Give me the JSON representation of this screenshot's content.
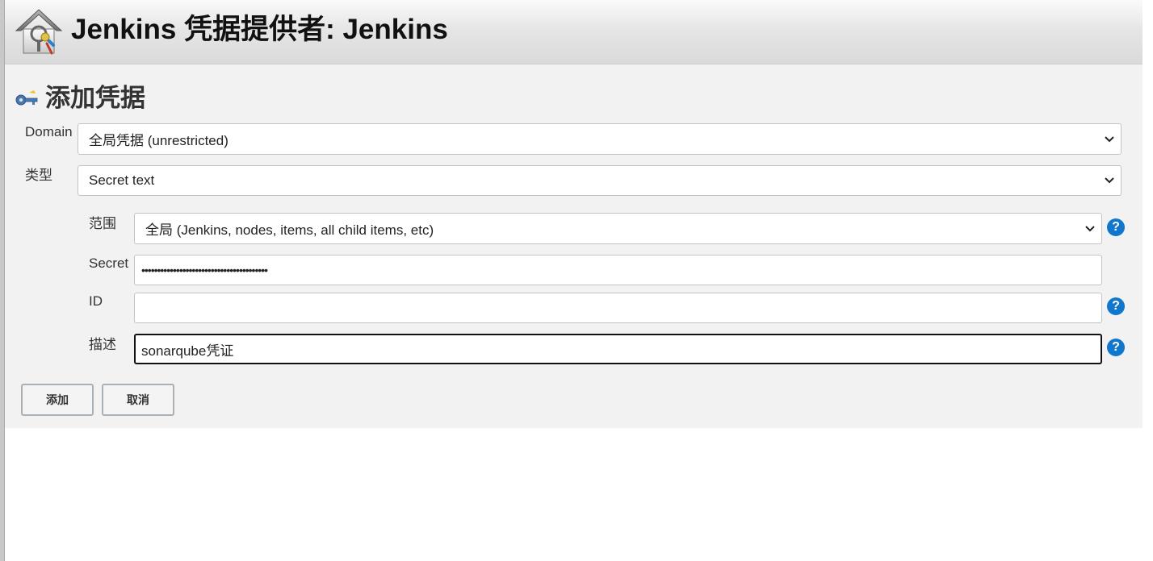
{
  "header": {
    "title": "Jenkins 凭据提供者: Jenkins",
    "icon": "credentials-house-key-icon"
  },
  "section": {
    "title": "添加凭据",
    "icon": "key-icon"
  },
  "form": {
    "domain": {
      "label": "Domain",
      "value": "全局凭据 (unrestricted)"
    },
    "kind": {
      "label": "类型",
      "value": "Secret text"
    },
    "scope": {
      "label": "范围",
      "value": "全局 (Jenkins, nodes, items, all child items, etc)"
    },
    "secret": {
      "label": "Secret",
      "value": "••••••••••••••••••••••••••••••••••••••••"
    },
    "id": {
      "label": "ID",
      "value": ""
    },
    "description": {
      "label": "描述",
      "value": "sonarqube凭证"
    },
    "help_glyph": "?"
  },
  "buttons": {
    "add": "添加",
    "cancel": "取消"
  },
  "colors": {
    "help": "#1177cc",
    "header_bg": "#dadada",
    "panel_bg": "#f2f2f2"
  }
}
